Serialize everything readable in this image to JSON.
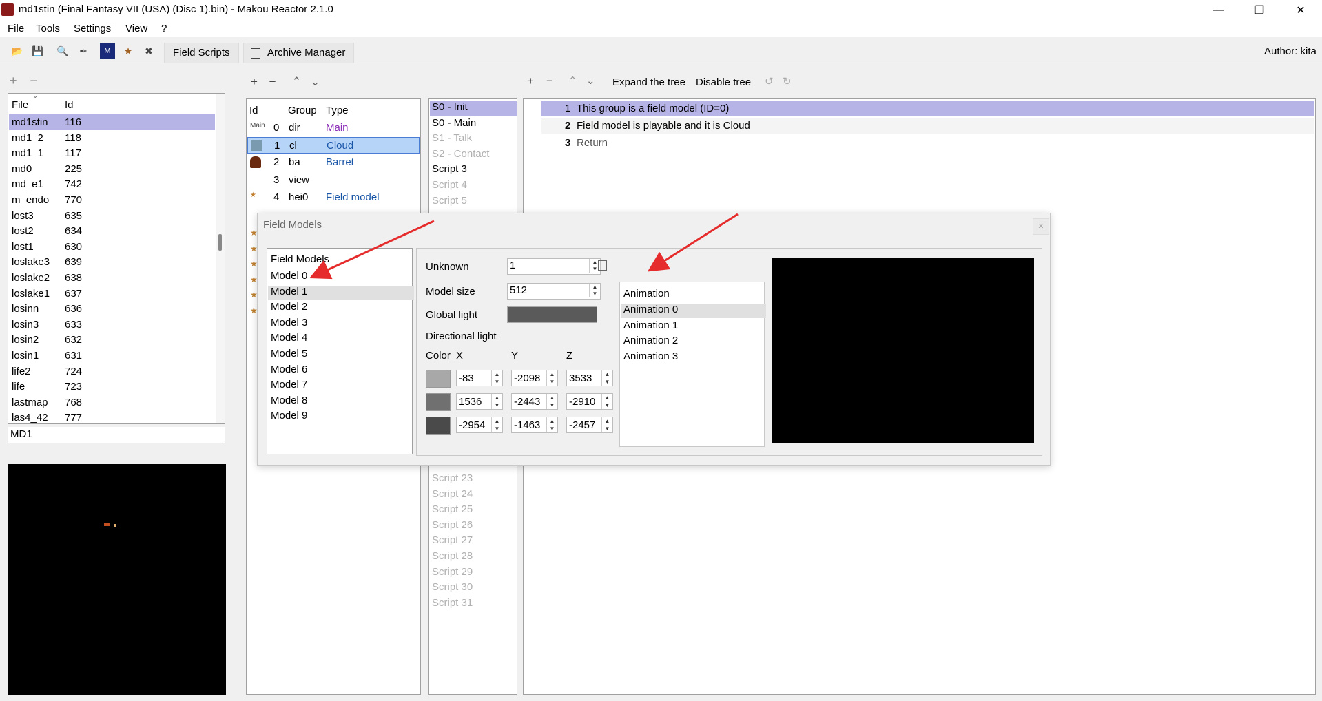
{
  "window": {
    "title": "md1stin (Final Fantasy VII (USA) (Disc 1).bin) - Makou Reactor 2.1.0",
    "minimize": "—",
    "maximize": "❐",
    "close": "✕"
  },
  "menu": [
    "File",
    "Tools",
    "Settings",
    "View",
    "?"
  ],
  "toolbar": {
    "tabs": [
      "Field Scripts",
      "Archive Manager"
    ],
    "author": "Author: kita"
  },
  "file_list": {
    "add": "+",
    "remove": "−",
    "headers": [
      "File",
      "Id"
    ],
    "rows": [
      [
        "md1stin",
        "116"
      ],
      [
        "md1_2",
        "118"
      ],
      [
        "md1_1",
        "117"
      ],
      [
        "md0",
        "225"
      ],
      [
        "md_e1",
        "742"
      ],
      [
        "m_endo",
        "770"
      ],
      [
        "lost3",
        "635"
      ],
      [
        "lost2",
        "634"
      ],
      [
        "lost1",
        "630"
      ],
      [
        "loslake3",
        "639"
      ],
      [
        "loslake2",
        "638"
      ],
      [
        "loslake1",
        "637"
      ],
      [
        "losinn",
        "636"
      ],
      [
        "losin3",
        "633"
      ],
      [
        "losin2",
        "632"
      ],
      [
        "losin1",
        "631"
      ],
      [
        "life2",
        "724"
      ],
      [
        "life",
        "723"
      ],
      [
        "lastmap",
        "768"
      ],
      [
        "las4_42",
        "777"
      ]
    ],
    "filter_value": "MD1"
  },
  "group_list": {
    "headers": [
      "Id",
      "Group",
      "Type"
    ],
    "rows": [
      {
        "id": "0",
        "group": "dir",
        "type": "Main",
        "icon": "main-icon",
        "color": "purple",
        "icontext": "Main"
      },
      {
        "id": "1",
        "group": "cl",
        "type": "Cloud",
        "icon": "cloud-icon",
        "color": "blue",
        "icontext": ""
      },
      {
        "id": "2",
        "group": "ba",
        "type": "Barret",
        "icon": "barret-icon",
        "color": "blue",
        "icontext": ""
      },
      {
        "id": "3",
        "group": "view",
        "type": "",
        "icon": "",
        "color": "",
        "icontext": ""
      },
      {
        "id": "4",
        "group": "hei0",
        "type": "Field model",
        "icon": "field-model-icon",
        "color": "blue",
        "icontext": ""
      }
    ]
  },
  "script_list": {
    "top": [
      "S0 - Init",
      "S0 - Main",
      "S1 - Talk",
      "S2 - Contact",
      "Script 3",
      "Script 4",
      "Script 5"
    ],
    "bottom": [
      "Script 23",
      "Script 24",
      "Script 25",
      "Script 26",
      "Script 27",
      "Script 28",
      "Script 29",
      "Script 30",
      "Script 31"
    ]
  },
  "script_toolbar": {
    "expand": "Expand the tree",
    "disable": "Disable tree"
  },
  "opcodes": [
    {
      "num": "1",
      "text": "This group is a field model (ID=0)"
    },
    {
      "num": "2",
      "text": "Field model is playable and it is Cloud"
    },
    {
      "num": "3",
      "text": "Return"
    }
  ],
  "dialog": {
    "title": "Field Models",
    "close": "✕",
    "models_header": "Field Models",
    "models": [
      "Model 0",
      "Model 1",
      "Model 2",
      "Model 3",
      "Model 4",
      "Model 5",
      "Model 6",
      "Model 7",
      "Model 8",
      "Model 9"
    ],
    "unknown_label": "Unknown",
    "unknown_value": "1",
    "model_size_label": "Model size",
    "model_size_value": "512",
    "global_light_label": "Global light",
    "directional_light_label": "Directional light",
    "col_color": "Color",
    "col_x": "X",
    "col_y": "Y",
    "col_z": "Z",
    "lights": [
      {
        "color": "#a8a8a8",
        "x": "-83",
        "y": "-2098",
        "z": "3533"
      },
      {
        "color": "#707070",
        "x": "1536",
        "y": "-2443",
        "z": "-2910"
      },
      {
        "color": "#4a4a4a",
        "x": "-2954",
        "y": "-1463",
        "z": "-2457"
      }
    ],
    "global_light_color": "#5a5a5a",
    "animation_header": "Animation",
    "animations": [
      "Animation 0",
      "Animation 1",
      "Animation 2",
      "Animation 3"
    ]
  }
}
